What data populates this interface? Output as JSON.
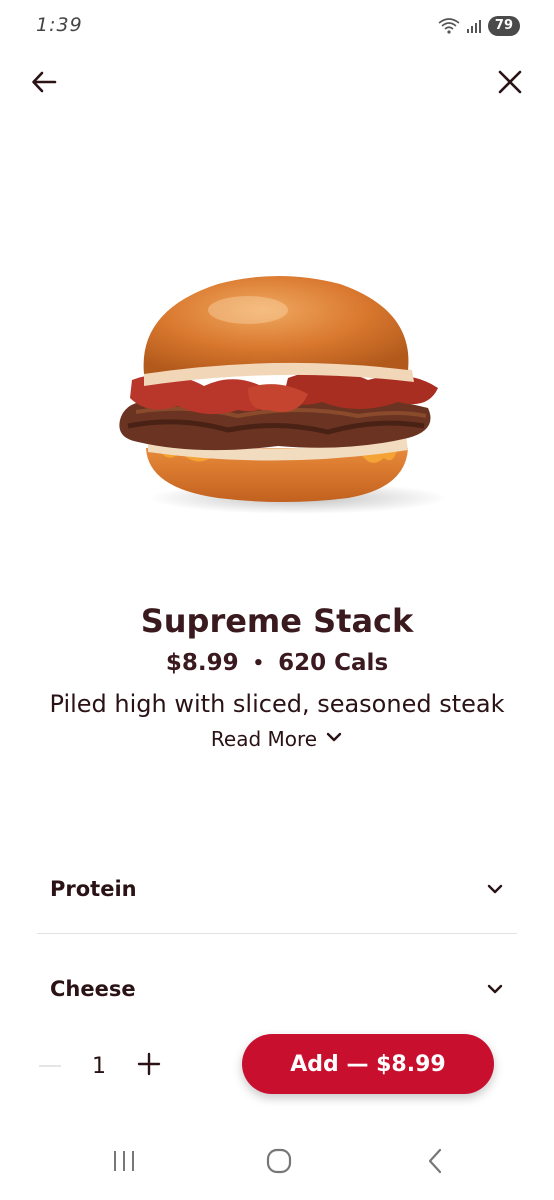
{
  "status_bar": {
    "time": "1:39",
    "battery": "79"
  },
  "product": {
    "title": "Supreme Stack",
    "price": "$8.99",
    "separator": "•",
    "calories": "620 Cals",
    "description": "Piled high with sliced, seasoned steak",
    "read_more": "Read More"
  },
  "options": [
    {
      "label": "Protein"
    },
    {
      "label": "Cheese"
    }
  ],
  "order": {
    "quantity": "1",
    "add_label": "Add — $8.99"
  },
  "colors": {
    "brand": "#c8102e",
    "text": "#2a1215"
  },
  "icons": {
    "back": "arrow-left-icon",
    "close": "close-icon",
    "chevron": "chevron-down-icon",
    "plus": "plus-icon",
    "minus": "minus-icon"
  }
}
